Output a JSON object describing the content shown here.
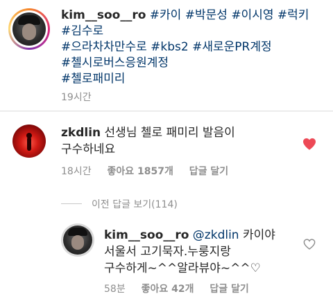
{
  "post": {
    "username": "kim__soo__ro",
    "caption_lines": [
      [
        "#카이",
        "#박문성",
        "#이시영",
        "#럭키"
      ],
      [
        "#김수로"
      ],
      [
        "#으라차차만수로",
        "#kbs2",
        "#새로운PR계정"
      ],
      [
        "#첼시로버스응원계정"
      ],
      [
        "#첼로패미리"
      ]
    ],
    "time": "19시간"
  },
  "comments": [
    {
      "username": "zkdlin",
      "text_line1": "선생님 첼로 패미리 발음이",
      "text_line2": "구수하네요",
      "time": "18시간",
      "likes": "좋아요 1857개",
      "reply_label": "답글 달기",
      "liked": true
    }
  ],
  "view_replies": "이전 답글 보기(114)",
  "reply": {
    "username": "kim__soo__ro",
    "mention": "@zkdlin",
    "text_line1_suffix": "카이야",
    "text_line2": "서울서 고기묵자.누룽지랑",
    "text_line3": "구수하게~^^알라뷰야~^^♡",
    "time": "58분",
    "likes": "좋아요 42개",
    "reply_label": "답글 달기",
    "liked": false
  },
  "colors": {
    "hashtag": "#003569",
    "meta": "#8e8e8e",
    "heart_active": "#ed4956"
  },
  "icons": [
    "heart-filled-icon",
    "heart-outline-icon"
  ]
}
